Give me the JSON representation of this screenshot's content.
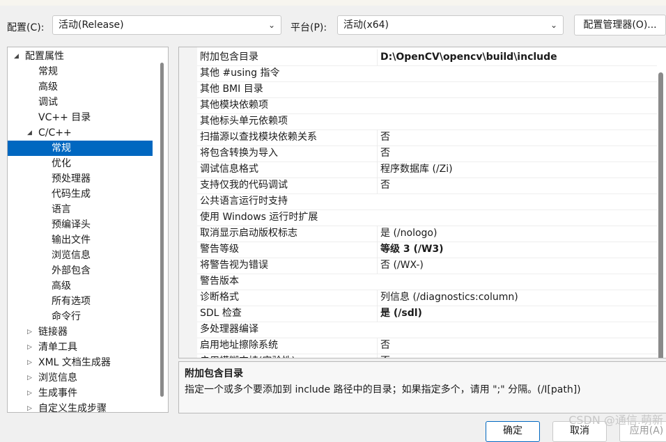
{
  "toolbar": {
    "config_label": "配置(C):",
    "config_value": "活动(Release)",
    "platform_label": "平台(P):",
    "platform_value": "活动(x64)",
    "config_manager_button": "配置管理器(O)..."
  },
  "tree": {
    "items": [
      {
        "label": "配置属性",
        "level": 0,
        "expander": "expanded",
        "selected": false
      },
      {
        "label": "常规",
        "level": 1,
        "expander": "none",
        "selected": false
      },
      {
        "label": "高级",
        "level": 1,
        "expander": "none",
        "selected": false
      },
      {
        "label": "调试",
        "level": 1,
        "expander": "none",
        "selected": false
      },
      {
        "label": "VC++ 目录",
        "level": 1,
        "expander": "none",
        "selected": false
      },
      {
        "label": "C/C++",
        "level": 1,
        "expander": "expanded",
        "selected": false
      },
      {
        "label": "常规",
        "level": 2,
        "expander": "none",
        "selected": true
      },
      {
        "label": "优化",
        "level": 2,
        "expander": "none",
        "selected": false
      },
      {
        "label": "预处理器",
        "level": 2,
        "expander": "none",
        "selected": false
      },
      {
        "label": "代码生成",
        "level": 2,
        "expander": "none",
        "selected": false
      },
      {
        "label": "语言",
        "level": 2,
        "expander": "none",
        "selected": false
      },
      {
        "label": "预编译头",
        "level": 2,
        "expander": "none",
        "selected": false
      },
      {
        "label": "输出文件",
        "level": 2,
        "expander": "none",
        "selected": false
      },
      {
        "label": "浏览信息",
        "level": 2,
        "expander": "none",
        "selected": false
      },
      {
        "label": "外部包含",
        "level": 2,
        "expander": "none",
        "selected": false
      },
      {
        "label": "高级",
        "level": 2,
        "expander": "none",
        "selected": false
      },
      {
        "label": "所有选项",
        "level": 2,
        "expander": "none",
        "selected": false
      },
      {
        "label": "命令行",
        "level": 2,
        "expander": "none",
        "selected": false
      },
      {
        "label": "链接器",
        "level": 1,
        "expander": "collapsed",
        "selected": false
      },
      {
        "label": "清单工具",
        "level": 1,
        "expander": "collapsed",
        "selected": false
      },
      {
        "label": "XML 文档生成器",
        "level": 1,
        "expander": "collapsed",
        "selected": false
      },
      {
        "label": "浏览信息",
        "level": 1,
        "expander": "collapsed",
        "selected": false
      },
      {
        "label": "生成事件",
        "level": 1,
        "expander": "collapsed",
        "selected": false
      },
      {
        "label": "自定义生成步骤",
        "level": 1,
        "expander": "collapsed",
        "selected": false
      }
    ]
  },
  "grid": {
    "rows": [
      {
        "name": "附加包含目录",
        "value": "D:\\OpenCV\\opencv\\build\\include",
        "bold": true
      },
      {
        "name": "其他 #using 指令",
        "value": "",
        "bold": false
      },
      {
        "name": "其他 BMI 目录",
        "value": "",
        "bold": false
      },
      {
        "name": "其他模块依赖项",
        "value": "",
        "bold": false
      },
      {
        "name": "其他标头单元依赖项",
        "value": "",
        "bold": false
      },
      {
        "name": "扫描源以查找模块依赖关系",
        "value": "否",
        "bold": false
      },
      {
        "name": "将包含转换为导入",
        "value": "否",
        "bold": false
      },
      {
        "name": "调试信息格式",
        "value": "程序数据库 (/Zi)",
        "bold": false
      },
      {
        "name": "支持仅我的代码调试",
        "value": "否",
        "bold": false
      },
      {
        "name": "公共语言运行时支持",
        "value": "",
        "bold": false
      },
      {
        "name": "使用 Windows 运行时扩展",
        "value": "",
        "bold": false
      },
      {
        "name": "取消显示启动版权标志",
        "value": "是 (/nologo)",
        "bold": false
      },
      {
        "name": "警告等级",
        "value": "等级 3 (/W3)",
        "bold": true
      },
      {
        "name": "将警告视为错误",
        "value": "否 (/WX-)",
        "bold": false
      },
      {
        "name": "警告版本",
        "value": "",
        "bold": false
      },
      {
        "name": "诊断格式",
        "value": "列信息 (/diagnostics:column)",
        "bold": false
      },
      {
        "name": "SDL 检查",
        "value": "是 (/sdl)",
        "bold": true
      },
      {
        "name": "多处理器编译",
        "value": "",
        "bold": false
      },
      {
        "name": "启用地址擦除系统",
        "value": "否",
        "bold": false
      },
      {
        "name": "启用模糊支持(实验性)",
        "value": "否",
        "bold": false
      }
    ]
  },
  "description": {
    "title": "附加包含目录",
    "text": "指定一个或多个要添加到 include 路径中的目录；如果指定多个，请用 \";\" 分隔。(/I[path])"
  },
  "footer": {
    "ok_label": "确定",
    "cancel_label": "取消",
    "apply_label": "应用(A)"
  },
  "watermark": "CSDN @通信.萌新"
}
